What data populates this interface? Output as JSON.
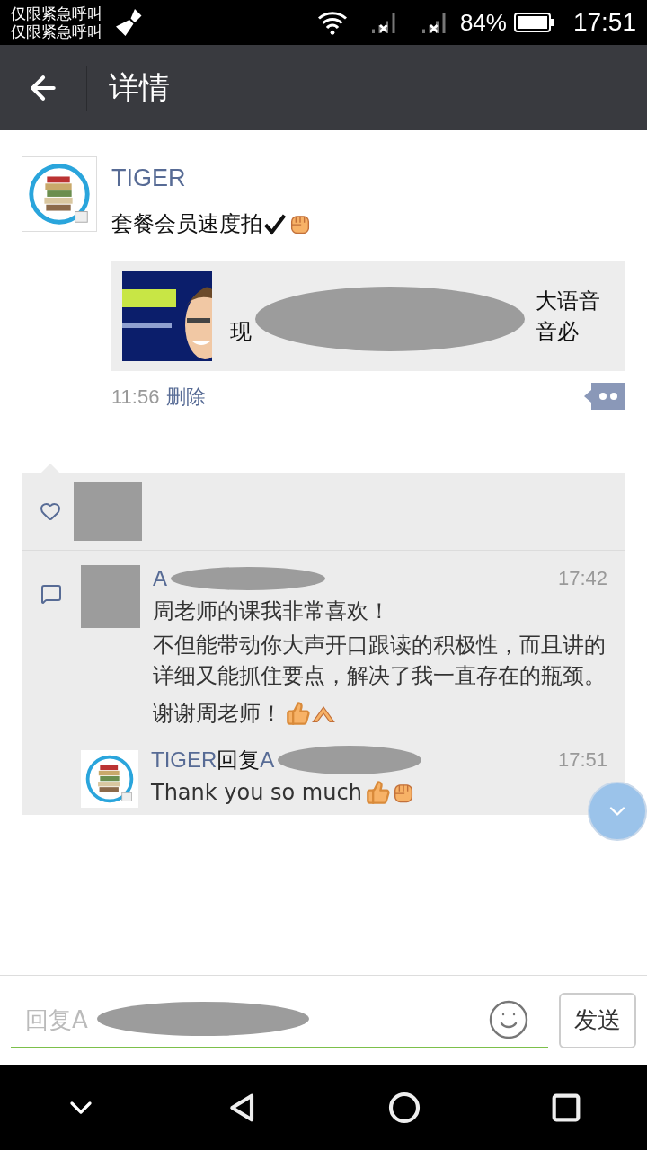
{
  "status_bar": {
    "notice_lines": [
      "仅限紧急呼叫",
      "仅限紧急呼叫"
    ],
    "battery": "84%",
    "time": "17:51"
  },
  "header": {
    "title": "详情"
  },
  "post": {
    "author": "TIGER",
    "text": "套餐会员速度拍",
    "link": {
      "line1_tail": "大语音",
      "line2_head": "现",
      "line2_tail": "音必"
    },
    "time": "11:56",
    "delete": "删除"
  },
  "comments": [
    {
      "kind": "comment",
      "author": "A",
      "time": "17:42",
      "paragraphs": [
        "周老师的课我非常喜欢！",
        "不但能带动你大声开口跟读的积极性，而且讲的详细又能抓住要点，解决了我一直存在的瓶颈。",
        "谢谢周老师！"
      ]
    },
    {
      "kind": "reply",
      "author": "TIGER",
      "reply_word": "回复",
      "target": "A",
      "time": "17:51",
      "paragraphs": [
        "Thank you so much"
      ]
    }
  ],
  "input": {
    "placeholder": "回复A",
    "send": "发送"
  }
}
